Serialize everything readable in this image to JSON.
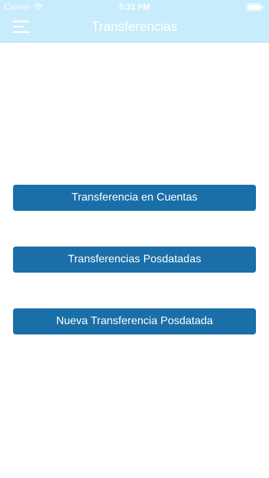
{
  "status_bar": {
    "carrier": "Carrier",
    "time": "5:31 PM"
  },
  "nav": {
    "title": "Transferencias",
    "menu_icon": "hamburger-menu-icon"
  },
  "actions": [
    {
      "label": "Transferencia en Cuentas"
    },
    {
      "label": "Transferencias Posdatadas"
    },
    {
      "label": "Nueva Transferencia Posdatada"
    }
  ],
  "colors": {
    "header_bg": "#c7ecfb",
    "button_bg": "#1a6fa9",
    "text_light": "#ffffff"
  }
}
